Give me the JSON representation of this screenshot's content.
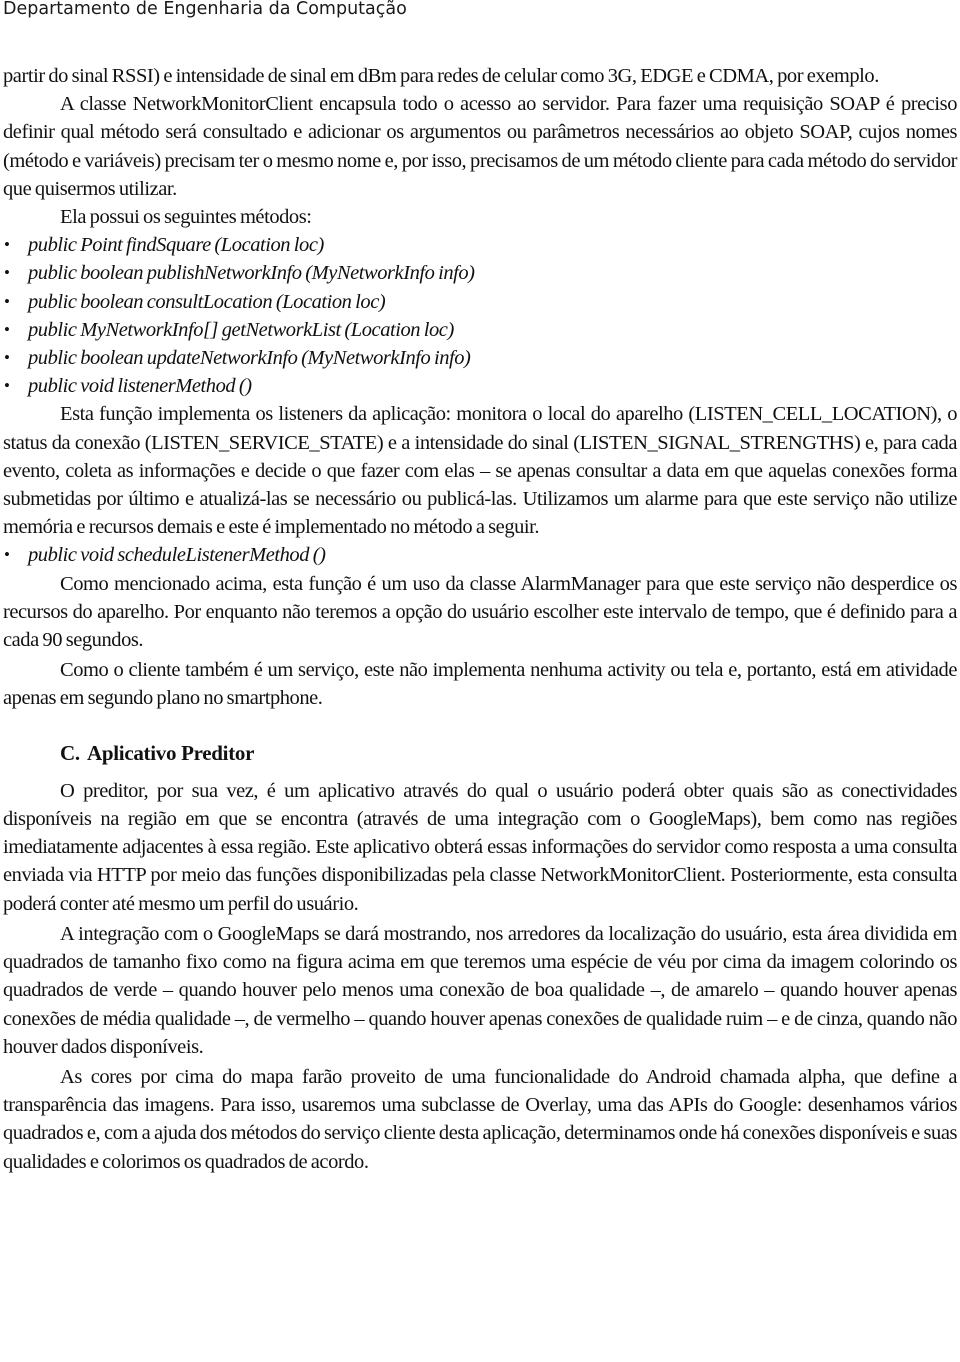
{
  "header": {
    "title": "Departamento de Engenharia da Computação"
  },
  "paragraphs": {
    "p1": "partir do sinal RSSI) e intensidade de sinal em dBm para redes de celular como 3G, EDGE e CDMA, por exemplo.",
    "p2": "A classe NetworkMonitorClient encapsula todo o acesso ao servidor. Para fazer uma requisição SOAP é preciso definir qual método será consultado e adicionar os argumentos ou parâmetros necessários ao objeto SOAP, cujos nomes (método e variáveis) precisam ter o mesmo nome e, por isso, precisamos de um método cliente para cada método do servidor que quisermos utilizar.",
    "p3": "Ela possui os seguintes métodos:",
    "p4": "Esta função implementa os listeners da aplicação: monitora o local do aparelho (LISTEN_CELL_LOCATION), o status da conexão (LISTEN_SERVICE_STATE) e a intensidade do sinal (LISTEN_SIGNAL_STRENGTHS) e, para cada evento, coleta as informações e decide o que fazer com elas – se apenas consultar a data em que aquelas conexões forma submetidas por último e atualizá-las se necessário ou publicá-las. Utilizamos um alarme para que este serviço não utilize memória e recursos demais e este é implementado no método a seguir.",
    "p5": "Como mencionado acima, esta função é um uso da classe AlarmManager para que este serviço não desperdice os recursos do aparelho. Por enquanto não teremos a opção do usuário escolher este intervalo de tempo, que é definido para a cada 90 segundos.",
    "p6": "Como o cliente também é um serviço, este não implementa nenhuma activity ou tela e, portanto, está em atividade apenas em segundo plano no smartphone.",
    "p7": "O preditor, por sua vez, é um aplicativo através do qual o usuário poderá obter quais são as conectividades disponíveis na região em que se encontra (através de uma integração com o GoogleMaps), bem como nas regiões imediatamente adjacentes à essa região. Este aplicativo obterá essas informações do servidor como resposta a uma consulta enviada via HTTP por meio das funções disponibilizadas pela classe NetworkMonitorClient. Posteriormente, esta consulta poderá conter até mesmo um perfil do usuário.",
    "p8": "A integração com o GoogleMaps se dará mostrando, nos arredores da localização do usuário, esta área dividida em quadrados de tamanho fixo como na figura acima em que teremos uma espécie de véu por cima da imagem colorindo os quadrados de verde – quando houver pelo menos uma conexão de boa qualidade –, de amarelo – quando houver apenas conexões de média qualidade –, de vermelho – quando houver apenas conexões de qualidade ruim – e de cinza, quando não houver dados disponíveis.",
    "p9": "As cores por cima do mapa farão proveito de uma funcionalidade do Android chamada alpha, que define a transparência das imagens. Para isso, usaremos uma subclasse de Overlay, uma das APIs do Google: desenhamos vários quadrados e, com a ajuda dos métodos do serviço cliente desta aplicação, determinamos onde há conexões disponíveis e suas qualidades e colorimos os quadrados de acordo."
  },
  "bullet_glyph": "•",
  "methods": [
    "public Point findSquare (Location loc)",
    "public boolean publishNetworkInfo (MyNetworkInfo info)",
    "public boolean consultLocation (Location loc)",
    "public MyNetworkInfo[] getNetworkList (Location loc)",
    "public boolean updateNetworkInfo (MyNetworkInfo info)",
    "public void listenerMethod ()"
  ],
  "scheduled_method": "public void scheduleListenerMethod ()",
  "section": {
    "number": "C.",
    "title": "Aplicativo Preditor"
  }
}
